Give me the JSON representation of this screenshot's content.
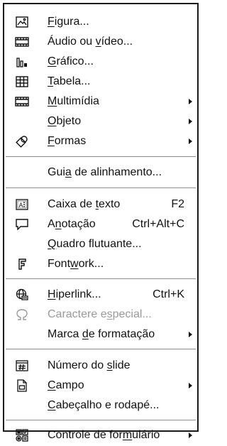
{
  "menu": {
    "items": [
      {
        "icon": "image-icon",
        "parts": [
          "",
          "F",
          "igura..."
        ],
        "submenu": false
      },
      {
        "icon": "video-icon",
        "parts": [
          "Áudio ou ",
          "v",
          "ídeo..."
        ],
        "submenu": false
      },
      {
        "icon": "chart-icon",
        "parts": [
          "",
          "G",
          "ráfico..."
        ],
        "submenu": false
      },
      {
        "icon": "table-icon",
        "parts": [
          "",
          "T",
          "abela..."
        ],
        "submenu": false
      },
      {
        "icon": "multimedia-icon",
        "parts": [
          "",
          "M",
          "ultimídia"
        ],
        "submenu": true
      },
      {
        "icon": "",
        "parts": [
          "",
          "O",
          "bjeto"
        ],
        "submenu": true
      },
      {
        "icon": "shapes-icon",
        "parts": [
          "",
          "F",
          "ormas"
        ],
        "submenu": true
      },
      {
        "icon": "",
        "parts": [
          "Gui",
          "a",
          " de alinhamento..."
        ],
        "submenu": false
      },
      {
        "icon": "text-box-icon",
        "parts": [
          "Caixa de ",
          "t",
          "exto"
        ],
        "accel": "F2",
        "submenu": false
      },
      {
        "icon": "comment-icon",
        "parts": [
          "A",
          "n",
          "otação"
        ],
        "accel": "Ctrl+Alt+C",
        "submenu": false
      },
      {
        "icon": "",
        "parts": [
          "",
          "Q",
          "uadro flutuante..."
        ],
        "submenu": false
      },
      {
        "icon": "fontwork-icon",
        "parts": [
          "Font",
          "w",
          "ork..."
        ],
        "submenu": false
      },
      {
        "icon": "hyperlink-icon",
        "parts": [
          "",
          "H",
          "iperlink..."
        ],
        "accel": "Ctrl+K",
        "submenu": false
      },
      {
        "icon": "special-character-icon",
        "parts": [
          "Caractere e",
          "s",
          "pecial..."
        ],
        "submenu": false,
        "disabled": true
      },
      {
        "icon": "",
        "parts": [
          "Marca ",
          "d",
          "e formatação"
        ],
        "submenu": true
      },
      {
        "icon": "slide-number-icon",
        "parts": [
          "Número do ",
          "s",
          "lide"
        ],
        "submenu": false
      },
      {
        "icon": "field-icon",
        "parts": [
          "",
          "C",
          "ampo"
        ],
        "submenu": true
      },
      {
        "icon": "",
        "parts": [
          "",
          "C",
          "abeçalho e rodapé..."
        ],
        "submenu": false
      },
      {
        "icon": "form-control-icon",
        "parts": [
          "Controle de for",
          "m",
          "ulário"
        ],
        "submenu": true
      }
    ]
  }
}
